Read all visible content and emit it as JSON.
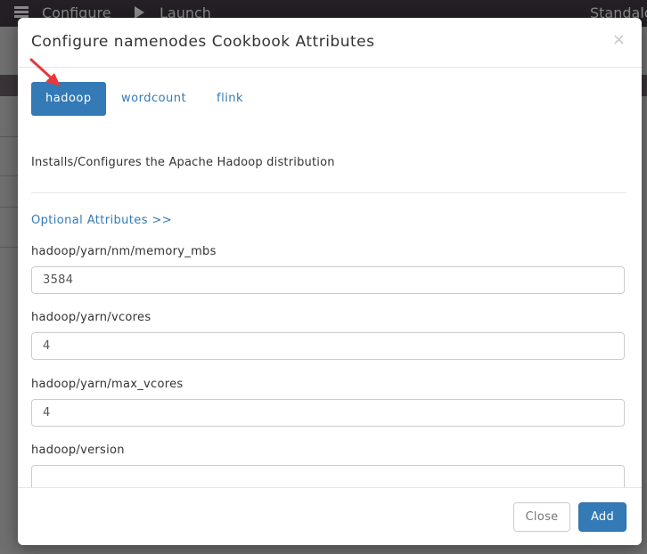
{
  "background": {
    "configure_label": "Configure",
    "launch_label": "Launch",
    "mode_label": "Standalone"
  },
  "modal": {
    "title": "Configure namenodes Cookbook Attributes",
    "close_glyph": "×",
    "tabs": [
      {
        "label": "hadoop",
        "active": true
      },
      {
        "label": "wordcount",
        "active": false
      },
      {
        "label": "flink",
        "active": false
      }
    ],
    "description": "Installs/Configures the Apache Hadoop distribution",
    "optional_link": "Optional Attributes >>",
    "fields": [
      {
        "label": "hadoop/yarn/nm/memory_mbs",
        "value": "3584"
      },
      {
        "label": "hadoop/yarn/vcores",
        "value": "4"
      },
      {
        "label": "hadoop/yarn/max_vcores",
        "value": "4"
      },
      {
        "label": "hadoop/version",
        "value": ""
      }
    ],
    "buttons": {
      "close_label": "Close",
      "add_label": "Add"
    }
  },
  "colors": {
    "primary": "#337ab7",
    "annotation_arrow": "#e8383d",
    "topbar": "#231f24"
  }
}
